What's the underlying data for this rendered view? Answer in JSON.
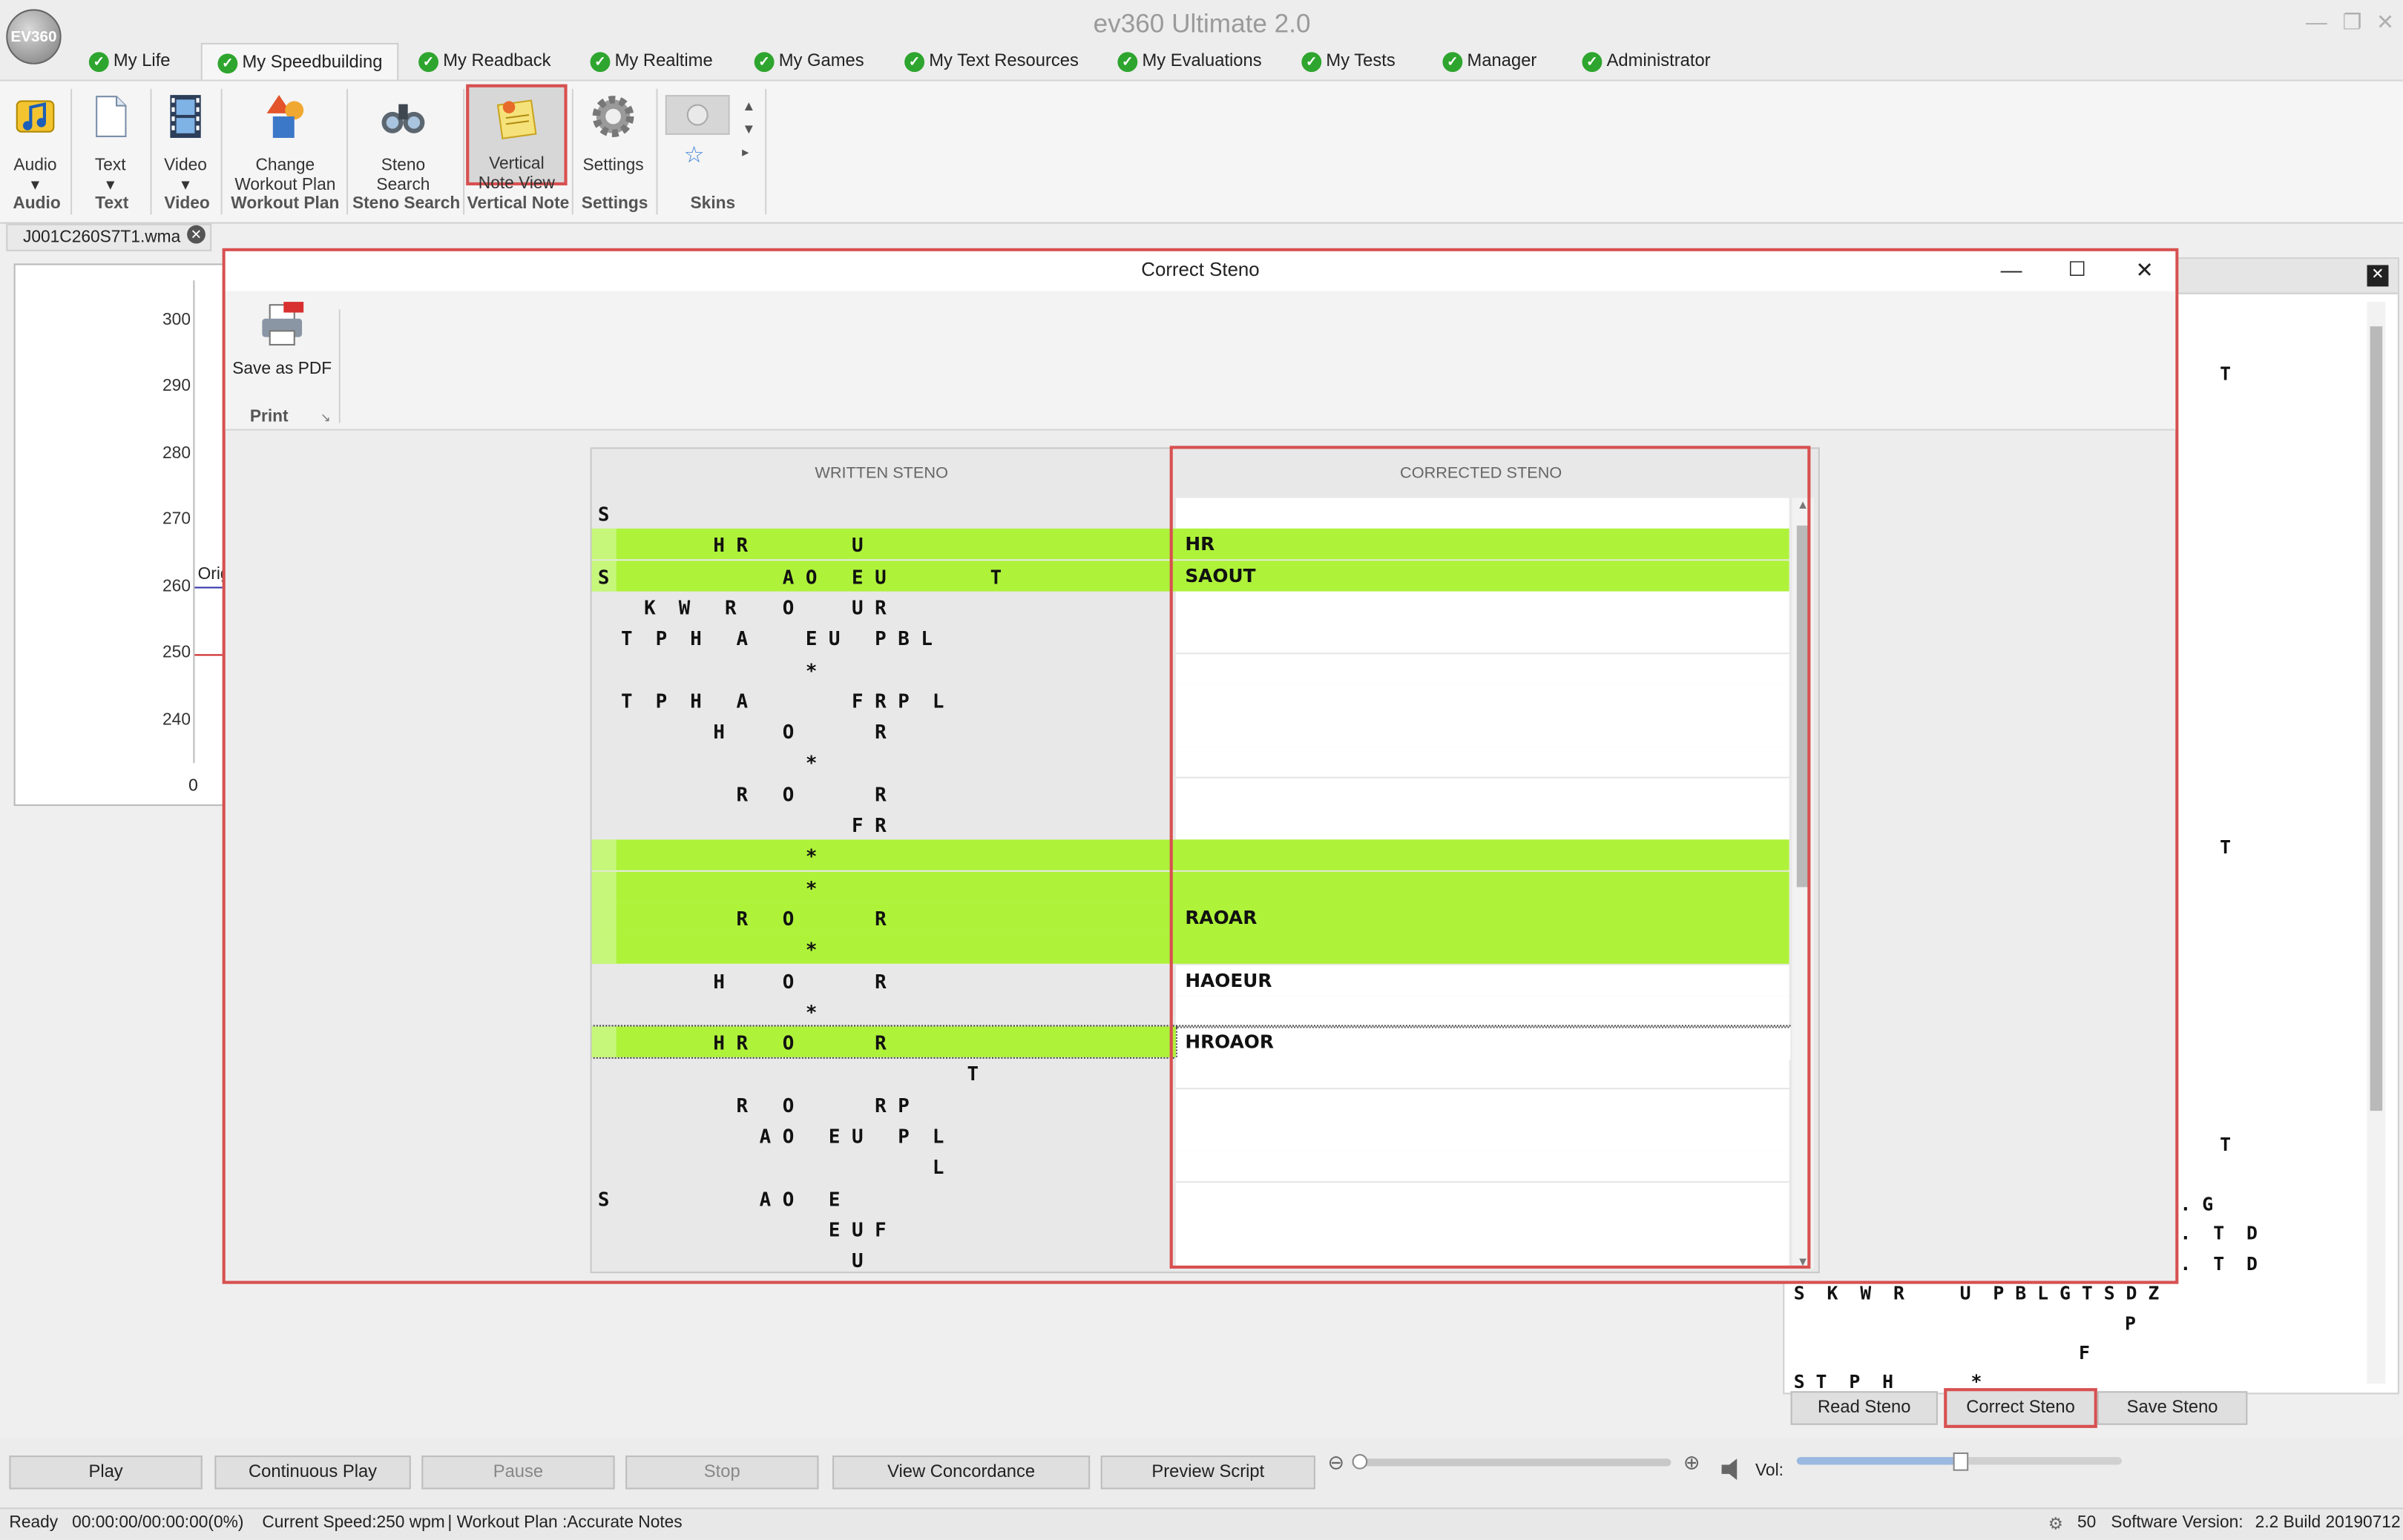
{
  "app": {
    "title": "ev360 Ultimate 2.0",
    "logo": "EV360"
  },
  "menu_tabs": [
    "My Life",
    "My Speedbuilding",
    "My Readback",
    "My Realtime",
    "My Games",
    "My Text Resources",
    "My Evaluations",
    "My Tests",
    "Manager",
    "Administrator"
  ],
  "ribbon": {
    "buttons": {
      "audio": "Audio",
      "text": "Text",
      "video": "Video",
      "change_workout": "Change Workout Plan",
      "steno_search": "Steno Search",
      "vertical_note": "Vertical Note View",
      "settings": "Settings"
    },
    "groups": {
      "audio": "Audio",
      "text": "Text",
      "video": "Video",
      "workout": "Workout Plan",
      "steno": "Steno Search",
      "vertical": "Vertical Note",
      "settings": "Settings",
      "skins": "Skins"
    }
  },
  "document_tab": "J001C260S7T1.wma",
  "chart": {
    "y_ticks": [
      "300",
      "290",
      "280",
      "270",
      "260",
      "250",
      "240"
    ],
    "x_tick": "0",
    "partial_label": "Orig"
  },
  "modal": {
    "title": "Correct Steno",
    "save_pdf": "Save as PDF",
    "print_group": "Print",
    "written_header": "WRITTEN STENO",
    "corrected_header": "CORRECTED STENO",
    "rows": [
      {
        "w": "S",
        "c": "",
        "hl": false
      },
      {
        "w": "          H R         U",
        "c": "HR",
        "hl": true
      },
      {
        "w": "S               A O   E U         T",
        "c": "SAOUT",
        "hl": true
      },
      {
        "w": "    K  W   R    O     U R",
        "c": "",
        "hl": false
      },
      {
        "w": "  T  P  H   A     E U   P B L",
        "c": "",
        "hl": false
      },
      {
        "w": "                  *",
        "c": "",
        "hl": false
      },
      {
        "w": "  T  P  H   A         F R P  L",
        "c": "",
        "hl": false
      },
      {
        "w": "          H     O       R",
        "c": "",
        "hl": false
      },
      {
        "w": "                  *",
        "c": "",
        "hl": false
      },
      {
        "w": "            R   O       R",
        "c": "",
        "hl": false
      },
      {
        "w": "                      F R",
        "c": "",
        "hl": false
      },
      {
        "w": "                  *",
        "c": "",
        "hl": true
      },
      {
        "w": "                  *",
        "c": "",
        "hl": true
      },
      {
        "w": "            R   O       R",
        "c": "RAOAR",
        "hl": true
      },
      {
        "w": "                  *",
        "c": "",
        "hl": true
      },
      {
        "w": "          H     O       R",
        "c": "HAOEUR",
        "hl": false
      },
      {
        "w": "                  *",
        "c": "",
        "hl": false
      },
      {
        "w": "          H R   O       R",
        "c": "HROAOR",
        "hl": true
      },
      {
        "w": "                                T",
        "c": "",
        "hl": false
      },
      {
        "w": "            R   O       R P",
        "c": "",
        "hl": false
      },
      {
        "w": "              A O   E U   P  L",
        "c": "",
        "hl": false
      },
      {
        "w": "                             L",
        "c": "",
        "hl": false
      },
      {
        "w": "S             A O   E",
        "c": "",
        "hl": false
      },
      {
        "w": "                    E U F",
        "c": "",
        "hl": false
      },
      {
        "w": "                      U",
        "c": "",
        "hl": false
      }
    ]
  },
  "right_panel": {
    "steno_lines": [
      "T",
      "T",
      "T",
      ". G",
      ".  T  D",
      ".  T  D",
      "S  K  W  R     U  P B L G T S D Z",
      "P",
      "F",
      "S T  P  H       *"
    ],
    "buttons": {
      "read": "Read Steno",
      "correct": "Correct Steno",
      "save": "Save Steno"
    }
  },
  "playbar": {
    "play": "Play",
    "continuous": "Continuous Play",
    "pause": "Pause",
    "stop": "Stop",
    "concordance": "View Concordance",
    "preview": "Preview  Script",
    "vol_label": "Vol:"
  },
  "status": {
    "ready": "Ready",
    "time": "00:00:00/00:00:00(0%)",
    "speed": "Current Speed:250 wpm",
    "workout": "| Workout Plan :Accurate Notes",
    "count": "50",
    "version_label": "Software Version:",
    "version": "2.2 Build 20190712"
  },
  "colors": {
    "highlight": "#aef23a",
    "accent_red": "#d85050",
    "check_green": "#2ea52e"
  }
}
